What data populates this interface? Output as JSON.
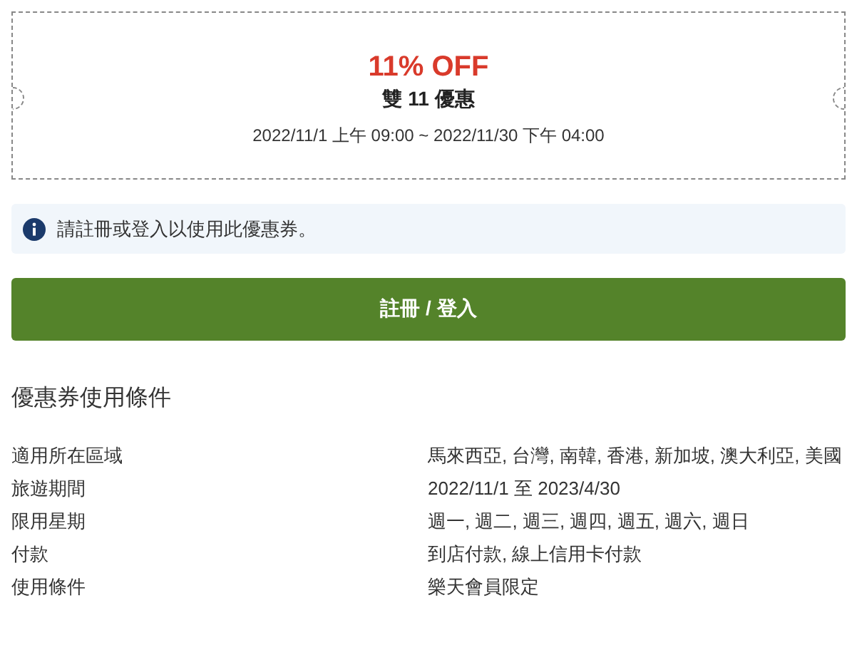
{
  "coupon": {
    "discount": "11% OFF",
    "name": "雙 11 優惠",
    "validity": "2022/11/1 上午 09:00 ~ 2022/11/30 下午 04:00"
  },
  "notice": {
    "text": "請註冊或登入以使用此優惠券。"
  },
  "login_button": {
    "label": "註冊 / 登入"
  },
  "conditions": {
    "title": "優惠券使用條件",
    "rows": [
      {
        "label": "適用所在區域",
        "value": "馬來西亞, 台灣, 南韓, 香港, 新加坡, 澳大利亞, 美國"
      },
      {
        "label": "旅遊期間",
        "value": "2022/11/1 至 2023/4/30"
      },
      {
        "label": "限用星期",
        "value": "週一, 週二, 週三, 週四, 週五, 週六, 週日"
      },
      {
        "label": "付款",
        "value": "到店付款, 線上信用卡付款"
      },
      {
        "label": "使用條件",
        "value": "樂天會員限定"
      }
    ]
  }
}
